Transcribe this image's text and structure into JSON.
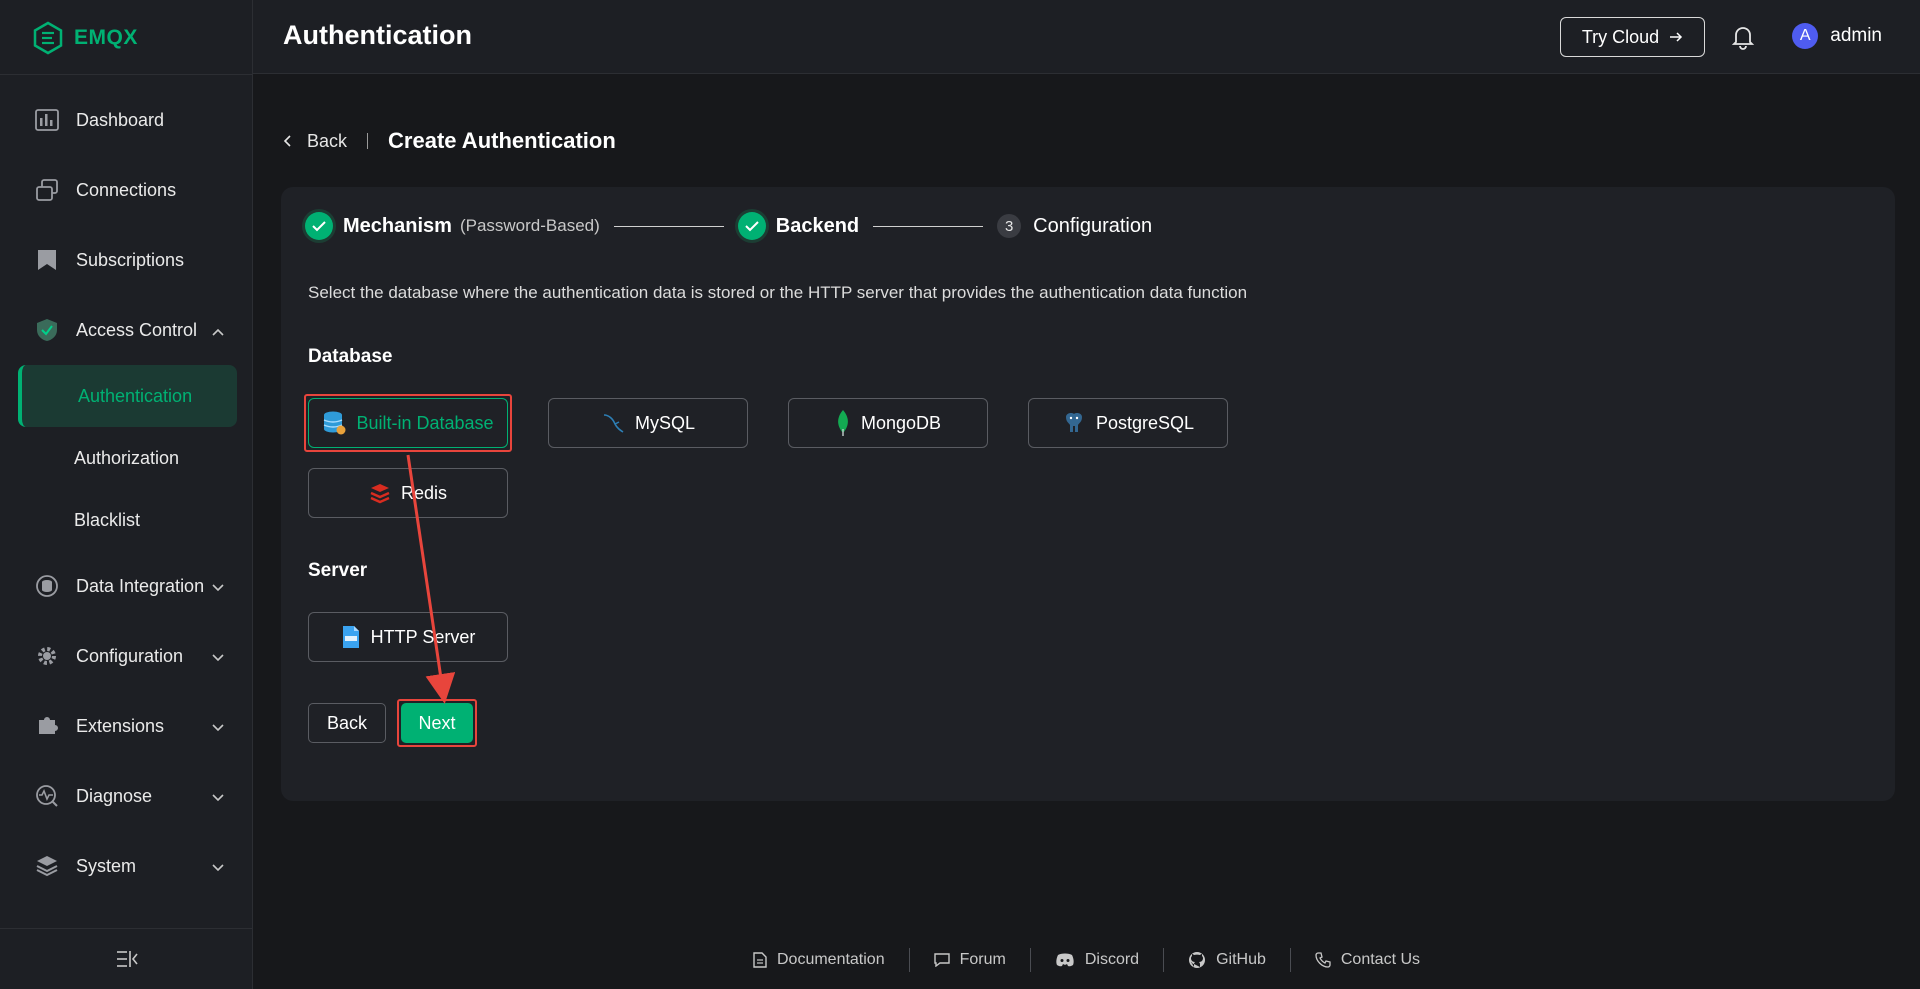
{
  "app": {
    "logo_text": "EMQX"
  },
  "header": {
    "title": "Authentication",
    "try_cloud_label": "Try Cloud",
    "user_initial": "A",
    "user_name": "admin"
  },
  "sidebar": {
    "items": [
      {
        "label": "Dashboard",
        "icon": "dashboard-icon"
      },
      {
        "label": "Connections",
        "icon": "connections-icon"
      },
      {
        "label": "Subscriptions",
        "icon": "subscriptions-icon"
      },
      {
        "label": "Access Control",
        "icon": "shield-check-icon",
        "expanded": true
      },
      {
        "label": "Data Integration",
        "icon": "data-integration-icon"
      },
      {
        "label": "Configuration",
        "icon": "gear-icon"
      },
      {
        "label": "Extensions",
        "icon": "puzzle-icon"
      },
      {
        "label": "Diagnose",
        "icon": "diagnose-icon"
      },
      {
        "label": "System",
        "icon": "layers-icon"
      }
    ],
    "sub_items": [
      {
        "label": "Authentication",
        "active": true
      },
      {
        "label": "Authorization",
        "active": false
      },
      {
        "label": "Blacklist",
        "active": false
      }
    ]
  },
  "breadcrumb": {
    "back_label": "Back",
    "title": "Create Authentication"
  },
  "steps": {
    "step1_title": "Mechanism",
    "step1_desc": "(Password-Based)",
    "step2_title": "Backend",
    "step3_number": "3",
    "step3_title": "Configuration"
  },
  "content": {
    "description": "Select the database where the authentication data is stored or the HTTP server that provides the authentication data function",
    "database_title": "Database",
    "server_title": "Server",
    "options": {
      "builtin": "Built-in Database",
      "mysql": "MySQL",
      "mongodb": "MongoDB",
      "postgresql": "PostgreSQL",
      "redis": "Redis",
      "http": "HTTP Server"
    },
    "back_button": "Back",
    "next_button": "Next"
  },
  "footer": {
    "documentation": "Documentation",
    "forum": "Forum",
    "discord": "Discord",
    "github": "GitHub",
    "contact": "Contact Us"
  },
  "colors": {
    "accent": "#00b173",
    "highlight": "#e8453c"
  }
}
